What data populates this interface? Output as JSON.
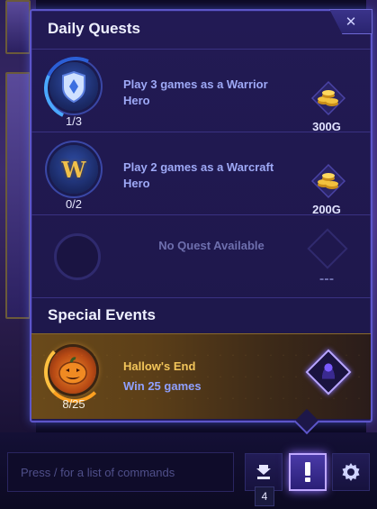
{
  "panel": {
    "close_symbol": "✕",
    "daily_title": "Daily Quests",
    "special_title": "Special Events"
  },
  "quests": [
    {
      "icon": "warrior-shield-icon",
      "glyph": "⬢",
      "text": "Play 3 games as a Warrior Hero",
      "progress": "1/3",
      "reward": "300G",
      "reward_icon": "gold-coins-icon"
    },
    {
      "icon": "warcraft-w-icon",
      "glyph": "W",
      "text": "Play 2 games as a Warcraft Hero",
      "progress": "0/2",
      "reward": "200G",
      "reward_icon": "gold-coins-icon"
    }
  ],
  "empty_quest": {
    "text": "No Quest Available",
    "reward": "---"
  },
  "special_event": {
    "icon": "jack-o-lantern-icon",
    "title": "Hallow's End",
    "description": "Win 25 games",
    "progress": "8/25",
    "reward_icon": "portrait-reward-icon"
  },
  "bottom_bar": {
    "chat_placeholder": "Press / for a list of commands",
    "download_count": "4",
    "download_icon": "download-arrow-icon",
    "quests_icon": "exclamation-icon",
    "settings_icon": "gear-icon"
  },
  "colors": {
    "panel_border": "#5d56c9",
    "panel_bg": "#1d1749",
    "quest_text": "#9ea9f6",
    "event_title": "#f2c55a",
    "gold": "#f0c030"
  }
}
